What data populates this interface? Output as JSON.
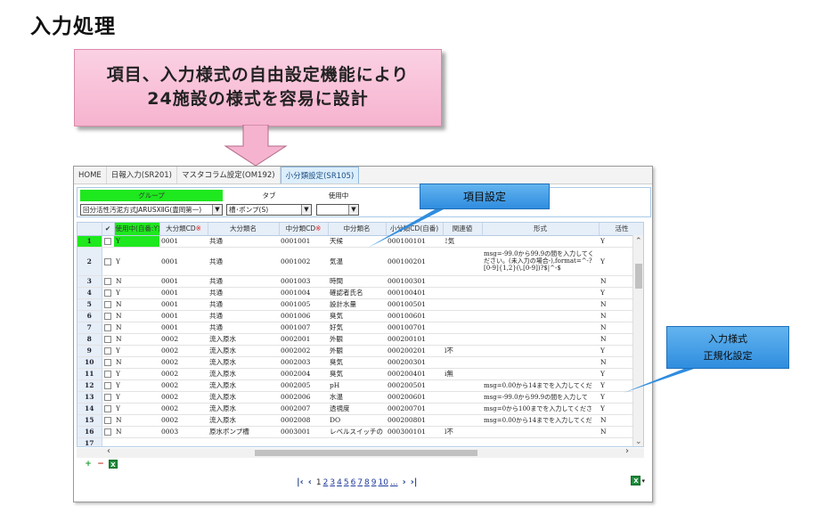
{
  "slide": {
    "title": "入力処理",
    "callout_main_line1": "項目、入力様式の自由設定機能により",
    "callout_main_line2": "24施設の様式を容易に設計",
    "callout_item": "項目設定",
    "callout_regex_line1": "入力様式",
    "callout_regex_line2": "正規化設定"
  },
  "tabs": [
    {
      "label": "HOME"
    },
    {
      "label": "日報入力(SR201)"
    },
    {
      "label": "マスタコラム設定(OM192)"
    },
    {
      "label": "小分類設定(SR105)"
    }
  ],
  "filters": {
    "group_label": "グループ",
    "group_value": "回分活性汚泥方式JARUSXⅡG(豊岡第一)",
    "type_label": "タブ",
    "type_value": "槽･ポンプ(S)",
    "use_label": "使用中",
    "use_value": ""
  },
  "grid": {
    "headers": {
      "check": "✔",
      "use": "使用中(自番:Y)",
      "large_cd": "大分類CD",
      "large_name": "大分類名",
      "mid_cd": "中分類CD",
      "mid_name": "中分類名",
      "small_cd": "小分類CD(自番)",
      "related": "関連値",
      "format": "形式",
      "active": "活性"
    },
    "required_mark": "※",
    "rows": [
      {
        "n": "1",
        "use": "Y",
        "lcd": "0001",
        "lname": "共通",
        "mcd": "0001001",
        "mname": "天候",
        "scd": "000100101",
        "rel": "ﾐ気",
        "fmt": "",
        "act": "Y"
      },
      {
        "n": "2",
        "use": "Y",
        "lcd": "0001",
        "lname": "共通",
        "mcd": "0001002",
        "mname": "気温",
        "scd": "000100201",
        "rel": "",
        "fmt": "msg=-99.0から99.9の間を入力してください。(未入力の場合-),format=^-?[0-9]{1,2}(\\.[0-9])?$|^-$",
        "act": "Y"
      },
      {
        "n": "3",
        "use": "N",
        "lcd": "0001",
        "lname": "共通",
        "mcd": "0001003",
        "mname": "時間",
        "scd": "000100301",
        "rel": "",
        "fmt": "",
        "act": "N"
      },
      {
        "n": "4",
        "use": "Y",
        "lcd": "0001",
        "lname": "共通",
        "mcd": "0001004",
        "mname": "確認者氏名",
        "scd": "000100401",
        "rel": "",
        "fmt": "",
        "act": "Y"
      },
      {
        "n": "5",
        "use": "N",
        "lcd": "0001",
        "lname": "共通",
        "mcd": "0001005",
        "mname": "設計水量",
        "scd": "000100501",
        "rel": "",
        "fmt": "",
        "act": "N"
      },
      {
        "n": "6",
        "use": "N",
        "lcd": "0001",
        "lname": "共通",
        "mcd": "0001006",
        "mname": "臭気",
        "scd": "000100601",
        "rel": "",
        "fmt": "",
        "act": "N"
      },
      {
        "n": "7",
        "use": "N",
        "lcd": "0001",
        "lname": "共通",
        "mcd": "0001007",
        "mname": "好気",
        "scd": "000100701",
        "rel": "",
        "fmt": "",
        "act": "N"
      },
      {
        "n": "8",
        "use": "N",
        "lcd": "0002",
        "lname": "流入原水",
        "mcd": "0002001",
        "mname": "外観",
        "scd": "000200101",
        "rel": "",
        "fmt": "",
        "act": "N"
      },
      {
        "n": "9",
        "use": "Y",
        "lcd": "0002",
        "lname": "流入原水",
        "mcd": "0002002",
        "mname": "外観",
        "scd": "000200201",
        "rel": "l不",
        "fmt": "",
        "act": "Y"
      },
      {
        "n": "10",
        "use": "N",
        "lcd": "0002",
        "lname": "流入原水",
        "mcd": "0002003",
        "mname": "臭気",
        "scd": "000200301",
        "rel": "",
        "fmt": "",
        "act": "N"
      },
      {
        "n": "11",
        "use": "Y",
        "lcd": "0002",
        "lname": "流入原水",
        "mcd": "0002004",
        "mname": "臭気",
        "scd": "000200401",
        "rel": "i無",
        "fmt": "",
        "act": "Y"
      },
      {
        "n": "12",
        "use": "Y",
        "lcd": "0002",
        "lname": "流入原水",
        "mcd": "0002005",
        "mname": "pH",
        "scd": "000200501",
        "rel": "",
        "fmt": "msg=0.00から14までを入力してくだ",
        "act": "Y"
      },
      {
        "n": "13",
        "use": "Y",
        "lcd": "0002",
        "lname": "流入原水",
        "mcd": "0002006",
        "mname": "水温",
        "scd": "000200601",
        "rel": "",
        "fmt": "msg=-99.0から99.9の間を入力して",
        "act": "Y"
      },
      {
        "n": "14",
        "use": "Y",
        "lcd": "0002",
        "lname": "流入原水",
        "mcd": "0002007",
        "mname": "透視度",
        "scd": "000200701",
        "rel": "",
        "fmt": "msg=0から100までを入力してくださ",
        "act": "Y"
      },
      {
        "n": "15",
        "use": "N",
        "lcd": "0002",
        "lname": "流入原水",
        "mcd": "0002008",
        "mname": "DO",
        "scd": "000200801",
        "rel": "",
        "fmt": "msg=0.00から14までを入力してくだ",
        "act": "N"
      },
      {
        "n": "16",
        "use": "N",
        "lcd": "0003",
        "lname": "原水ポンプ槽",
        "mcd": "0003001",
        "mname": "レベルスイッチの",
        "scd": "000300101",
        "rel": "l不",
        "fmt": "",
        "act": "N"
      },
      {
        "n": "17",
        "use": "",
        "lcd": "",
        "lname": "",
        "mcd": "",
        "mname": "",
        "scd": "",
        "rel": "",
        "fmt": "",
        "act": ""
      }
    ]
  },
  "pager": {
    "pages": [
      "1",
      "2",
      "3",
      "4",
      "5",
      "6",
      "7",
      "8",
      "9",
      "10",
      "..."
    ],
    "current": "1"
  },
  "icons": {
    "add_row": "plus-icon",
    "remove_row": "minus-icon",
    "excel": "excel-icon"
  },
  "colors": {
    "accent_green": "#1ee81e",
    "callout_pink": "#f6b3cf",
    "callout_blue": "#2f8ddf"
  }
}
